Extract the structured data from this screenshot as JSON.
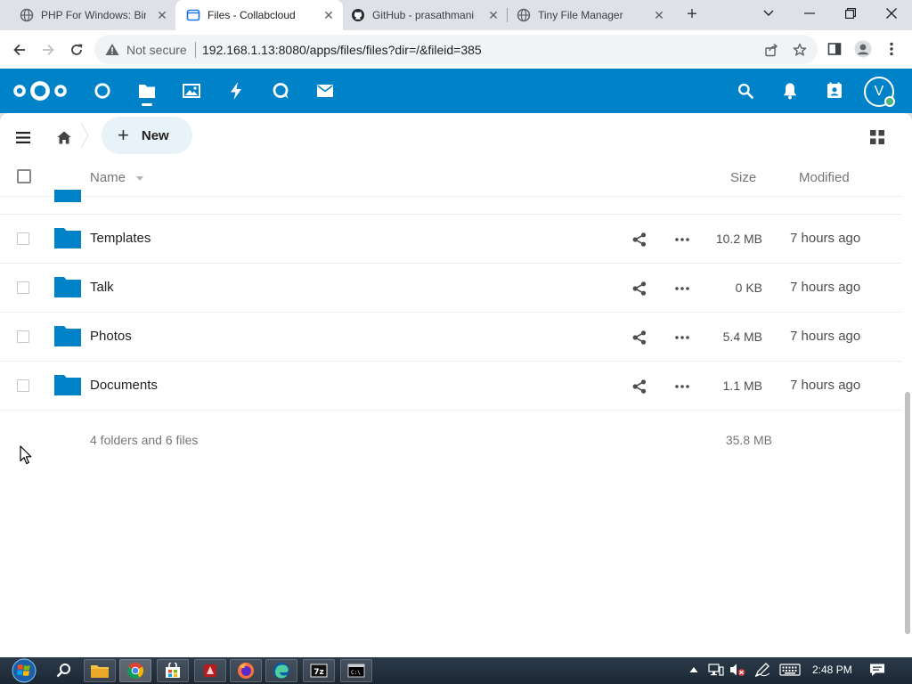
{
  "browser": {
    "tabs": [
      {
        "title": "PHP For Windows: Bin",
        "favicon": "globe-icon",
        "active": false
      },
      {
        "title": "Files - Collabcloud",
        "favicon": "files-icon",
        "active": true
      },
      {
        "title": "GitHub - prasathmani",
        "favicon": "github-icon",
        "active": false
      },
      {
        "title": "Tiny File Manager",
        "favicon": "globe-icon",
        "active": false
      }
    ],
    "security_label": "Not secure",
    "url": "192.168.1.13:8080/apps/files/files?dir=/&fileid=385"
  },
  "header": {
    "apps": [
      "dashboard-icon",
      "files-icon",
      "photos-icon",
      "activity-icon",
      "talk-icon",
      "mail-icon"
    ],
    "active_app": "files",
    "avatar_letter": "V",
    "brand_color": "#0082c9"
  },
  "controls": {
    "new_label": "New"
  },
  "table": {
    "columns": {
      "name": "Name",
      "size": "Size",
      "modified": "Modified"
    },
    "rows": [
      {
        "name": "Templates",
        "size": "10.2 MB",
        "modified": "7 hours ago"
      },
      {
        "name": "Talk",
        "size": "0 KB",
        "modified": "7 hours ago"
      },
      {
        "name": "Photos",
        "size": "5.4 MB",
        "modified": "7 hours ago"
      },
      {
        "name": "Documents",
        "size": "1.1 MB",
        "modified": "7 hours ago"
      }
    ],
    "summary": {
      "text": "4 folders and 6 files",
      "size": "35.8 MB"
    }
  },
  "taskbar": {
    "time": "2:48 PM"
  }
}
